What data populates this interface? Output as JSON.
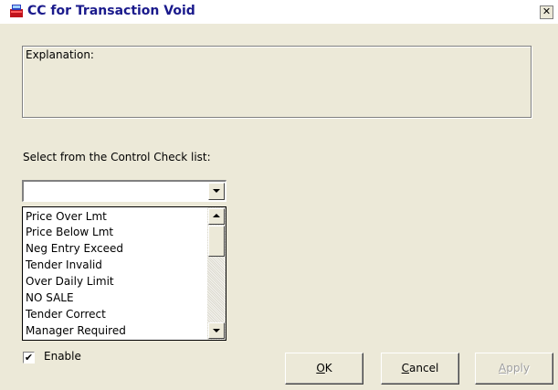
{
  "window": {
    "title": "CC for Transaction Void",
    "close_glyph": "✕"
  },
  "explanation": {
    "label": "Explanation:"
  },
  "control_check": {
    "label": "Select from the Control Check list:",
    "selected_value": "",
    "items": [
      "Price Over Lmt",
      "Price Below Lmt",
      "Neg Entry Exceed",
      "Tender Invalid",
      "Over Daily Limit",
      "NO SALE",
      "Tender Correct",
      "Manager Required"
    ]
  },
  "enable": {
    "label": "Enable",
    "checked": true,
    "check_glyph": "✔"
  },
  "buttons": {
    "ok": {
      "mnemonic": "O",
      "rest": "K"
    },
    "cancel": {
      "mnemonic": "C",
      "rest": "ancel"
    },
    "apply": {
      "mnemonic": "A",
      "rest": "pply"
    }
  },
  "colors": {
    "dialog_bg": "#ece9d8",
    "title_text": "#1a1a8c"
  },
  "icons": {
    "app": "cash-register-icon",
    "dropdown": "chevron-down-icon",
    "scroll_up": "scroll-up-icon",
    "scroll_down": "scroll-down-icon"
  }
}
